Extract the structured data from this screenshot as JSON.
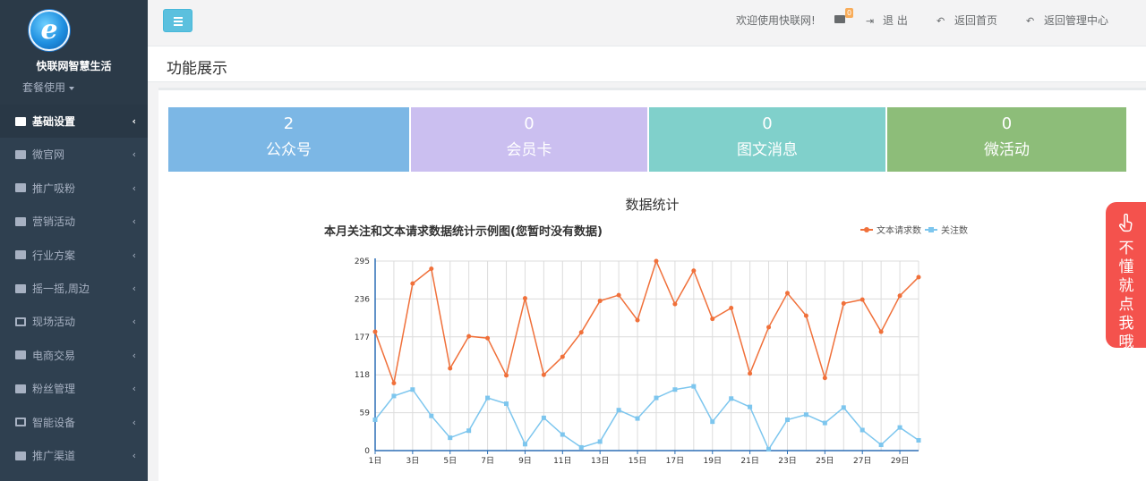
{
  "sidebar": {
    "brand_name": "快联网智慧生活",
    "plan_label": "套餐使用",
    "items": [
      {
        "label": "基础设置",
        "icon": "card-icon",
        "active": true
      },
      {
        "label": "微官网",
        "icon": "bank-icon"
      },
      {
        "label": "推广吸粉",
        "icon": "sitemap-icon"
      },
      {
        "label": "营销活动",
        "icon": "tag-icon"
      },
      {
        "label": "行业方案",
        "icon": "video-icon"
      },
      {
        "label": "摇一摇,周边",
        "icon": "wechat-icon"
      },
      {
        "label": "现场活动",
        "icon": "rss-icon"
      },
      {
        "label": "电商交易",
        "icon": "cart-icon"
      },
      {
        "label": "粉丝管理",
        "icon": "users-icon"
      },
      {
        "label": "智能设备",
        "icon": "device-icon"
      },
      {
        "label": "推广渠道",
        "icon": "bullhorn-icon"
      }
    ]
  },
  "topbar": {
    "welcome": "欢迎使用快联网!",
    "mail_badge": "0",
    "logout": "退 出",
    "home": "返回首页",
    "admin": "返回管理中心"
  },
  "page_title": "功能展示",
  "stats": [
    {
      "value": "2",
      "label": "公众号",
      "color": "#7cb7e5"
    },
    {
      "value": "0",
      "label": "会员卡",
      "color": "#cbbff0"
    },
    {
      "value": "0",
      "label": "图文消息",
      "color": "#80d0cb"
    },
    {
      "value": "0",
      "label": "微活动",
      "color": "#8dbd79"
    }
  ],
  "section_title": "数据统计",
  "help_text": "不懂就点我哦",
  "chart_data": {
    "type": "line",
    "title": "本月关注和文本请求数据统计示例图(您暂时没有数据)",
    "legend_position": "top-right",
    "grid": true,
    "x": [
      1,
      2,
      3,
      4,
      5,
      6,
      7,
      8,
      9,
      10,
      11,
      12,
      13,
      14,
      15,
      16,
      17,
      18,
      19,
      20,
      21,
      22,
      23,
      24,
      25,
      26,
      27,
      28,
      29,
      30
    ],
    "x_tick_labels": [
      "1日",
      "3日",
      "5日",
      "7日",
      "9日",
      "11日",
      "13日",
      "15日",
      "17日",
      "19日",
      "21日",
      "23日",
      "25日",
      "27日",
      "29日"
    ],
    "y_ticks": [
      "0",
      "59",
      "118",
      "177",
      "236",
      "295"
    ],
    "ylim": [
      0,
      295
    ],
    "series": [
      {
        "name": "文本请求数",
        "color": "#f0703a",
        "values": [
          185,
          105,
          260,
          283,
          128,
          178,
          175,
          117,
          237,
          118,
          146,
          184,
          233,
          242,
          203,
          295,
          228,
          280,
          205,
          222,
          120,
          192,
          245,
          210,
          113,
          229,
          235,
          185,
          241,
          270
        ]
      },
      {
        "name": "关注数",
        "color": "#7dc6ee",
        "values": [
          48,
          85,
          95,
          54,
          20,
          31,
          82,
          73,
          10,
          51,
          25,
          5,
          14,
          63,
          50,
          82,
          95,
          100,
          45,
          81,
          68,
          2,
          48,
          56,
          43,
          67,
          32,
          9,
          36,
          16
        ]
      }
    ]
  }
}
